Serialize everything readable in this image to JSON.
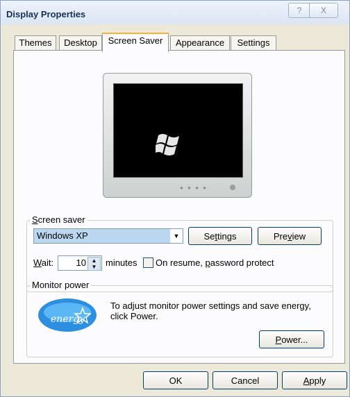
{
  "window": {
    "title": "Display Properties",
    "help_symbol": "?",
    "close_symbol": "X"
  },
  "tabs": [
    {
      "label": "Themes"
    },
    {
      "label": "Desktop"
    },
    {
      "label": "Screen Saver"
    },
    {
      "label": "Appearance"
    },
    {
      "label": "Settings"
    }
  ],
  "screen_saver": {
    "group_label_mnemonic": "S",
    "group_label_rest": "creen saver",
    "selected": "Windows XP",
    "settings_mnemonic_pre": "Se",
    "settings_mnemonic": "t",
    "settings_post": "tings",
    "preview_pre": "Pre",
    "preview_mnemonic": "v",
    "preview_post": "iew",
    "wait_mnemonic": "W",
    "wait_rest": "ait:",
    "wait_value": "10",
    "minutes_label": "minutes",
    "resume_pre": "On resume, ",
    "resume_mnemonic": "p",
    "resume_post": "assword protect"
  },
  "monitor_power": {
    "group_label": "Monitor power",
    "description_line1": "To adjust monitor power settings and save energy,",
    "description_line2": "click Power.",
    "power_mnemonic": "P",
    "power_rest": "ower...",
    "logo_text": "energy"
  },
  "footer": {
    "ok_label": "OK",
    "cancel_label": "Cancel",
    "apply_mnemonic": "A",
    "apply_rest": "pply"
  }
}
